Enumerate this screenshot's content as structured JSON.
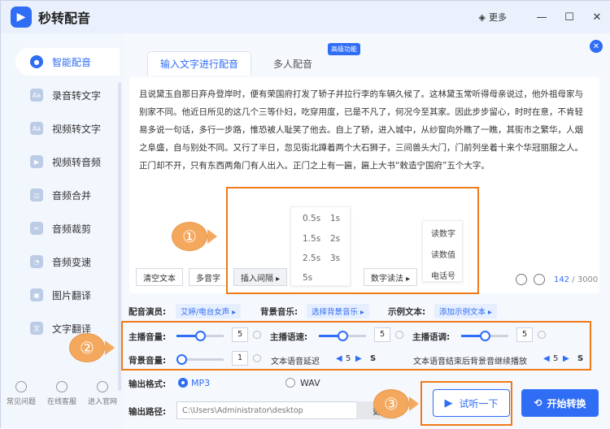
{
  "app": {
    "title": "秒转配音",
    "more": "更多"
  },
  "sidebar": {
    "items": [
      {
        "label": "智能配音",
        "icon": "mic-icon"
      },
      {
        "label": "录音转文字",
        "icon": "aa-icon"
      },
      {
        "label": "视频转文字",
        "icon": "video-text-icon"
      },
      {
        "label": "视频转音频",
        "icon": "video-audio-icon"
      },
      {
        "label": "音频合并",
        "icon": "merge-icon"
      },
      {
        "label": "音频裁剪",
        "icon": "crop-icon"
      },
      {
        "label": "音频变速",
        "icon": "speed-icon"
      },
      {
        "label": "图片翻译",
        "icon": "image-translate-icon"
      },
      {
        "label": "文字翻译",
        "icon": "text-translate-icon"
      }
    ],
    "bottom": [
      "常见问题",
      "在线客服",
      "进入官网"
    ]
  },
  "tabs": {
    "active": "输入文字进行配音",
    "other": "多人配音",
    "badge": "高级功能"
  },
  "editor": {
    "text": "且说黛玉自那日弃舟登岸时，便有荣国府打发了轿子并拉行李的车辆久候了。这林黛玉常听得母亲说过，他外祖母家与别家不同。他近日所见的这几个三等仆妇，吃穿用度，已是不凡了，何况今至其家。因此步步留心，时时在意，不肯轻易多说一句话，多行一步路，惟恐被人耻笑了他去。自上了轿，进入城中，从纱窗向外瞧了一瞧，其街市之繁华，人烟之阜盛，自与别处不同。又行了半日，忽见街北蹲着两个大石狮子，三间兽头大门，门前列坐着十来个华冠丽服之人。正门却不开，只有东西两角门有人出入。正门之上有一匾，匾上大书“敕造宁国府”五个大字。",
    "buttons": {
      "clear": "清空文本",
      "polyphone": "多音字",
      "pause": "插入间隔 ▸",
      "numread": "数字读法 ▸"
    },
    "pause_options": [
      "0.5s",
      "1s",
      "1.5s",
      "2s",
      "2.5s",
      "3s",
      "5s"
    ],
    "read_options": [
      "读数字",
      "读数值",
      "电话号"
    ],
    "count": "142",
    "max": "/ 3000"
  },
  "settings": {
    "voice_label": "配音演员:",
    "voice_value": "艾婷/电台女声 ▸",
    "bgm_label": "背景音乐:",
    "bgm_value": "选择背景音乐 ▸",
    "sample_label": "示例文本:",
    "sample_value": "添加示例文本 ▸",
    "volume_label": "主播音量:",
    "volume_value": "5",
    "volume_level": 0.5,
    "speed_label": "主播语速:",
    "speed_value": "5",
    "speed_level": 0.5,
    "pitch_label": "主播语调:",
    "pitch_value": "5",
    "pitch_level": 0.5,
    "bgvol_label": "背景音量:",
    "bgvol_value": "1",
    "bgvol_level": 0.1,
    "delay_label": "文本语音延迟",
    "delay_value": "5",
    "delay_unit": "S",
    "after_label": "文本语音结束后背景音继续播放",
    "after_value": "5",
    "after_unit": "S"
  },
  "output": {
    "format_label": "输出格式:",
    "mp3": "MP3",
    "wav": "WAV",
    "path_label": "输出路径:",
    "path_value": "C:\\Users\\Administrator\\desktop",
    "path_btn": "更"
  },
  "actions": {
    "listen": "试听一下",
    "start": "开始转换"
  },
  "annotations": [
    "①",
    "②",
    "③"
  ],
  "colors": {
    "accent": "#2f6df5",
    "highlight": "#f07a18",
    "marker": "#f4a85e"
  }
}
